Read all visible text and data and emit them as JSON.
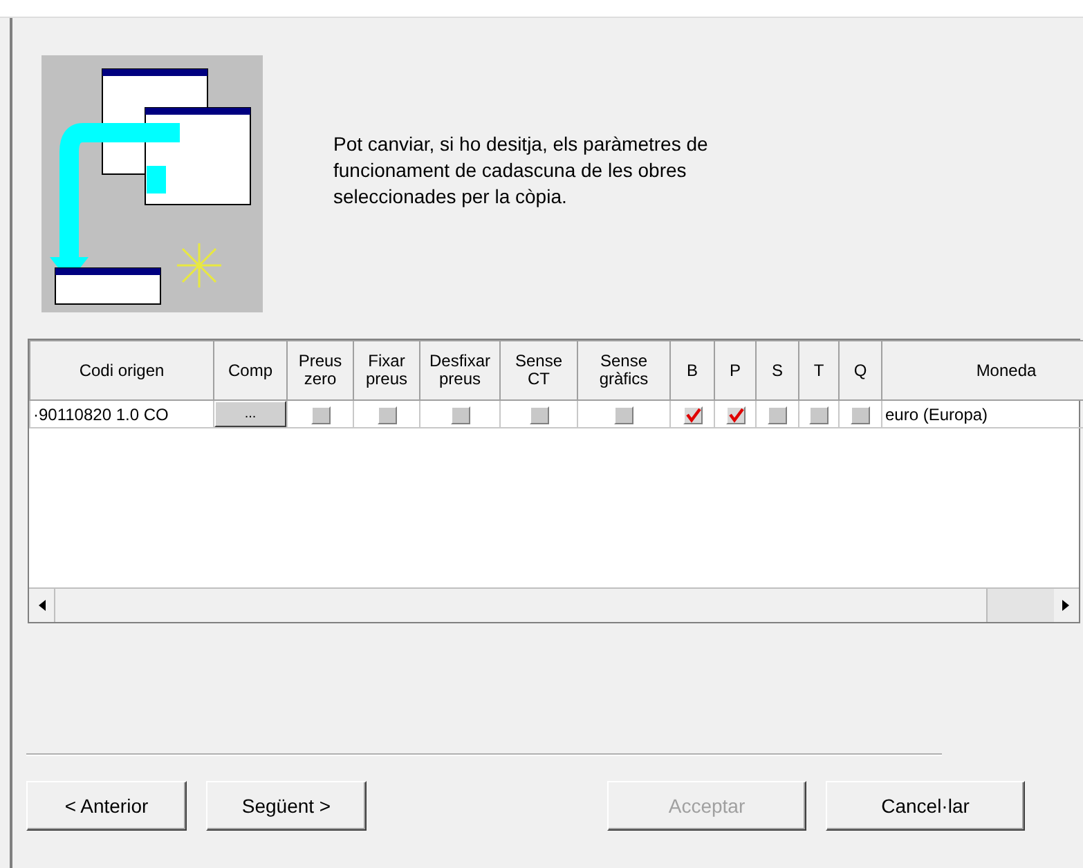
{
  "intro": {
    "text": "Pot canviar, si ho desitja, els paràmetres de funcionament de cadascuna de les obres seleccionades per la còpia."
  },
  "table": {
    "columns": [
      "Codi origen",
      "Comp",
      "Preus zero",
      "Fixar preus",
      "Desfixar preus",
      "Sense CT",
      "Sense gràfics",
      "B",
      "P",
      "S",
      "T",
      "Q",
      "Moneda"
    ],
    "rows": [
      {
        "cells": [
          {
            "kind": "text",
            "text": "·90110820 1.0 CO"
          },
          {
            "kind": "button",
            "text": "..."
          },
          {
            "kind": "checkbox",
            "checked": false
          },
          {
            "kind": "checkbox",
            "checked": false
          },
          {
            "kind": "checkbox",
            "checked": false
          },
          {
            "kind": "checkbox",
            "checked": false
          },
          {
            "kind": "checkbox",
            "checked": false
          },
          {
            "kind": "checkbox",
            "checked": true
          },
          {
            "kind": "checkbox",
            "checked": true
          },
          {
            "kind": "checkbox",
            "checked": false
          },
          {
            "kind": "checkbox",
            "checked": false
          },
          {
            "kind": "checkbox",
            "checked": false
          },
          {
            "kind": "text",
            "text": "euro (Europa)"
          }
        ]
      }
    ]
  },
  "buttons": [
    {
      "label": "< Anterior",
      "disabled": false
    },
    {
      "label": "Següent >",
      "disabled": false
    },
    {
      "label": "Acceptar",
      "disabled": true
    },
    {
      "label": "Cancel·lar",
      "disabled": false
    }
  ]
}
